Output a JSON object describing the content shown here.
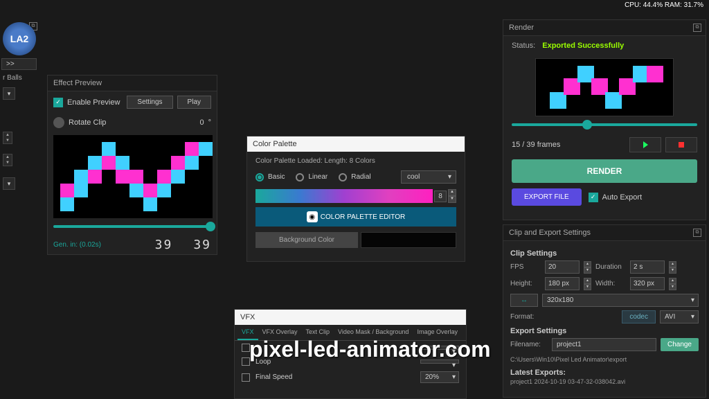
{
  "topbar": {
    "stats": "CPU: 44.4% RAM: 31.7%"
  },
  "logo": "LA2",
  "left": {
    "expand": ">>",
    "nav": "r Balls"
  },
  "effect_preview": {
    "title": "Effect Preview",
    "enable_label": "Enable Preview",
    "settings": "Settings",
    "play": "Play",
    "rotate_label": "Rotate Clip",
    "rotate_value": "0",
    "rotate_unit": "°",
    "gen": "Gen. in: (0.02s)",
    "d1": "39",
    "d2": "39"
  },
  "color_palette": {
    "title": "Color Palette",
    "info": "Color Palette Loaded: Length: 8 Colors",
    "basic": "Basic",
    "linear": "Linear",
    "radial": "Radial",
    "preset": "cool",
    "count": "8",
    "editor_btn": "COLOR PALETTE EDITOR",
    "bg_btn": "Background Color"
  },
  "vfx": {
    "title": "VFX",
    "tabs": [
      "VFX",
      "VFX Overlay",
      "Text Clip",
      "Video Mask / Background",
      "Image Overlay"
    ],
    "rows": [
      {
        "label": "",
        "value": ""
      },
      {
        "label": "Loop",
        "value": ""
      },
      {
        "label": "Final Speed",
        "value": "20%"
      }
    ]
  },
  "render": {
    "title": "Render",
    "status_label": "Status:",
    "status_value": "Exported Successfully",
    "frames": "15 / 39 frames",
    "render_btn": "RENDER",
    "export_btn": "EXPORT FILE",
    "auto_export": "Auto Export"
  },
  "clip_export": {
    "title": "Clip and Export Settings",
    "clip_section": "Clip Settings",
    "fps_label": "FPS",
    "fps": "20",
    "duration_label": "Duration",
    "duration": "2 s",
    "height_label": "Height:",
    "height": "180 px",
    "width_label": "Width:",
    "width": "320 px",
    "swap": "↔",
    "size_preset": "320x180",
    "format_label": "Format:",
    "codec": "codec",
    "format": "AVI",
    "export_section": "Export Settings",
    "filename_label": "Filename:",
    "filename": "project1",
    "change": "Change",
    "path": "C:\\Users\\Win10\\Pixel Led Animator\\export",
    "latest_label": "Latest Exports:",
    "latest_item": "project1 2024-10-19 03-47-32-038042.avi"
  },
  "watermark": "pixel-led-animator.com"
}
